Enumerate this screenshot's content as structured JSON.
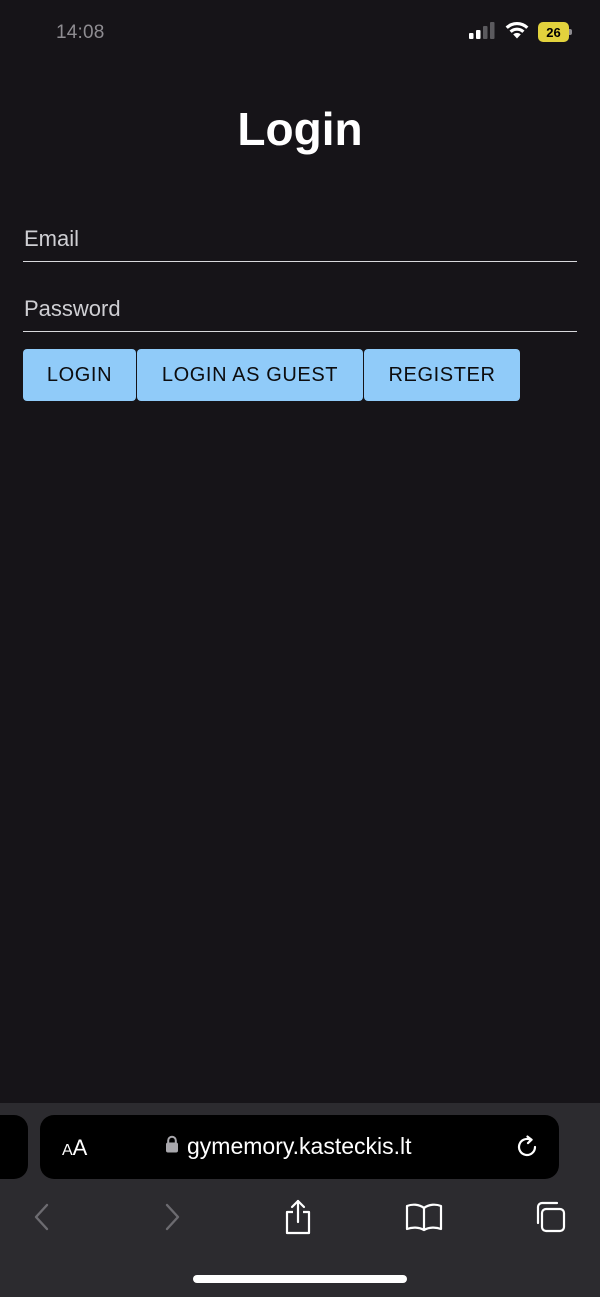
{
  "status_bar": {
    "time": "14:08",
    "battery": "26"
  },
  "page": {
    "title": "Login"
  },
  "form": {
    "email_placeholder": "Email",
    "email_value": "",
    "password_placeholder": "Password",
    "password_value": ""
  },
  "buttons": {
    "login": "LOGIN",
    "login_guest": "LOGIN AS GUEST",
    "register": "REGISTER"
  },
  "browser": {
    "aa_large": "A",
    "aa_small": "A",
    "url": "gymemory.kasteckis.lt",
    "icons": [
      "lock-icon",
      "reload-icon",
      "back-icon",
      "forward-icon",
      "share-icon",
      "bookmarks-icon",
      "tabs-icon"
    ]
  },
  "colors": {
    "background": "#161418",
    "button": "#90cbf9",
    "browser_chrome": "#2c2b2f",
    "battery": "#e2d23d"
  }
}
